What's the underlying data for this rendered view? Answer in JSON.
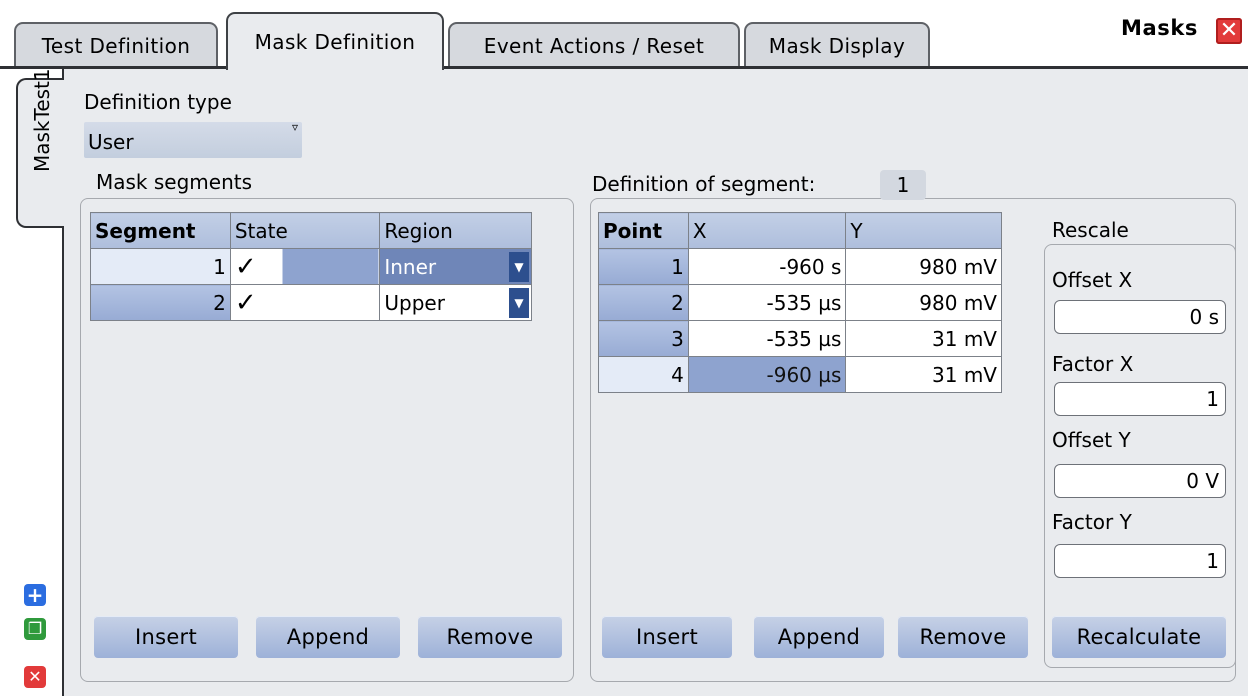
{
  "tabs": [
    "Test Definition",
    "Mask Definition",
    "Event Actions / Reset",
    "Mask Display"
  ],
  "window": {
    "title": "Masks",
    "close_glyph": "✕"
  },
  "side_tab": {
    "label": "MaskTest1"
  },
  "definition_type": {
    "label": "Definition type",
    "value": "User"
  },
  "mask_segments": {
    "title": "Mask segments",
    "columns": [
      "Segment",
      "State",
      "Region"
    ],
    "rows": [
      {
        "segment": "1",
        "state": "✓",
        "region": "Inner"
      },
      {
        "segment": "2",
        "state": "✓",
        "region": "Upper"
      }
    ],
    "buttons": [
      "Insert",
      "Append",
      "Remove"
    ]
  },
  "segment_definition": {
    "title": "Definition of segment:",
    "segment_number": "1",
    "columns": [
      "Point",
      "X",
      "Y"
    ],
    "rows": [
      {
        "point": "1",
        "x": "-960 s",
        "y": "980 mV"
      },
      {
        "point": "2",
        "x": "-535 µs",
        "y": "980 mV"
      },
      {
        "point": "3",
        "x": "-535 µs",
        "y": "31 mV"
      },
      {
        "point": "4",
        "x": "-960 µs",
        "y": "31 mV"
      }
    ],
    "buttons": [
      "Insert",
      "Append",
      "Remove"
    ]
  },
  "rescale": {
    "title": "Rescale",
    "offset_x": {
      "label": "Offset X",
      "value": "0 s"
    },
    "factor_x": {
      "label": "Factor X",
      "value": "1"
    },
    "offset_y": {
      "label": "Offset Y",
      "value": "0 V"
    },
    "factor_y": {
      "label": "Factor Y",
      "value": "1"
    },
    "recalculate": "Recalculate"
  },
  "side_icons": {
    "add": "+",
    "copy": "❐",
    "delete": "✕"
  },
  "colors": {
    "accent": "#2d4f8e",
    "header": "#aebedc",
    "selected": "#8ea3cf",
    "close": "#e23a3a"
  }
}
